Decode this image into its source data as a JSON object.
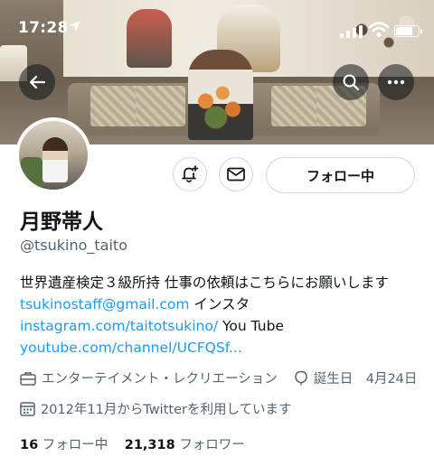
{
  "status_bar": {
    "time": "17:28",
    "battery_level": 0.8
  },
  "profile": {
    "name": "月野帯人",
    "handle": "@tsukino_taito",
    "bio": {
      "text1": "世界遺産検定３級所持 仕事の依頼はこちらにお願いします ",
      "email": "tsukinostaff@gmail.com",
      "text2": " インスタ ",
      "instagram": "instagram.com/taitotsukino/",
      "text3": " You Tube ",
      "youtube": "youtube.com/channel/UCFQSf..."
    },
    "category": "エンターテイメント・レクリエーション",
    "birthday": "誕生日　4月24日",
    "joined": "2012年11月からTwitterを利用しています",
    "following_count": "16",
    "following_label": "フォロー中",
    "followers_count": "21,318",
    "followers_label": "フォロワー"
  },
  "actions": {
    "follow_label": "フォロー中"
  },
  "icons": {
    "back": "back-arrow-icon",
    "search": "search-icon",
    "more": "more-icon",
    "notify": "bell-plus-icon",
    "message": "envelope-icon",
    "category": "briefcase-icon",
    "birthday": "balloon-icon",
    "joined": "calendar-icon"
  },
  "colors": {
    "link": "#1d9bf0",
    "text": "#0f1419",
    "muted": "#536471"
  }
}
